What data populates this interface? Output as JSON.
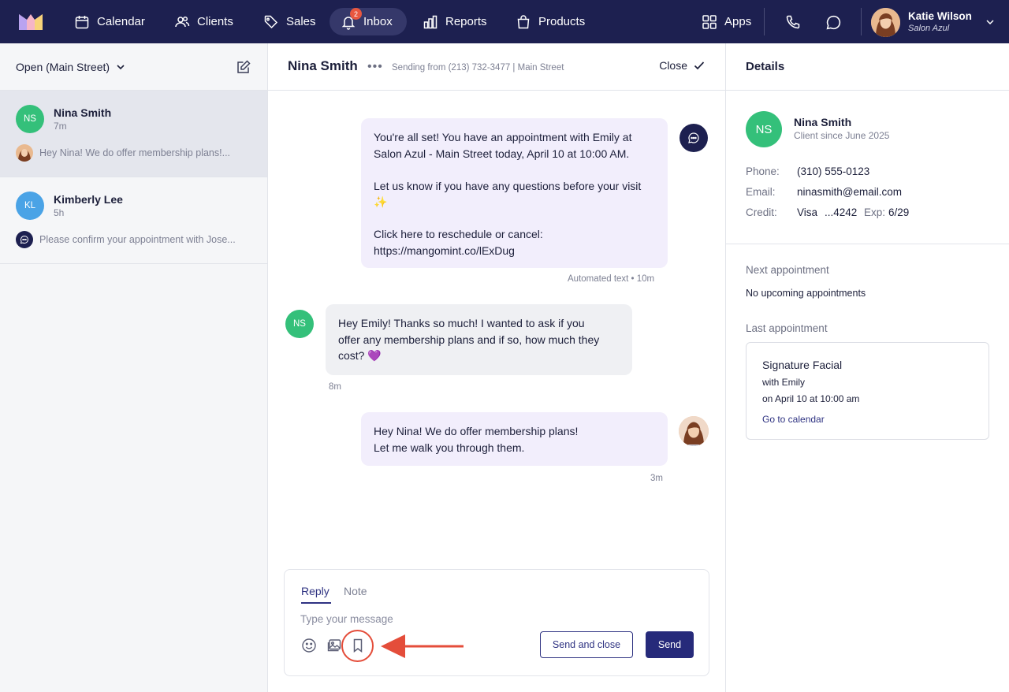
{
  "nav": {
    "items": [
      {
        "label": "Calendar",
        "icon": "calendar-icon"
      },
      {
        "label": "Clients",
        "icon": "clients-icon"
      },
      {
        "label": "Sales",
        "icon": "tag-icon"
      },
      {
        "label": "Inbox",
        "icon": "bell-icon",
        "badge": "2"
      },
      {
        "label": "Reports",
        "icon": "bar-chart-icon"
      },
      {
        "label": "Products",
        "icon": "bag-icon"
      }
    ],
    "apps_label": "Apps",
    "user_name": "Katie Wilson",
    "user_salon": "Salon Azul",
    "accent": "#1d2050",
    "badge_color": "#e8573f"
  },
  "inbox": {
    "filter_label": "Open (Main Street)",
    "conversations": [
      {
        "initials": "NS",
        "name": "Nina Smith",
        "time": "7m",
        "preview": "Hey Nina! We do offer membership plans!...",
        "avatar_color": "#34c07a"
      },
      {
        "initials": "KL",
        "name": "Kimberly Lee",
        "time": "5h",
        "preview": "Please confirm your appointment with Jose...",
        "avatar_color": "#4aa3e6"
      }
    ]
  },
  "chat": {
    "title": "Nina Smith",
    "sending_from": "Sending from (213) 732-3477 | Main Street",
    "close_label": "Close",
    "messages": [
      {
        "direction": "out",
        "lines": [
          "You're all set! You have an appointment with Emily at",
          "Salon Azul - Main Street today, April 10 at 10:00 AM.",
          "",
          "Let us know if you have any questions before your visit",
          "✨",
          "",
          "Click here to reschedule or cancel:",
          "https://mangomint.co/lExDug"
        ],
        "meta": "Automated text • 10m"
      },
      {
        "direction": "in",
        "lines": [
          "Hey Emily! Thanks so much! I wanted to ask if you",
          "offer any membership plans and if so, how much they",
          "cost? 💜"
        ],
        "meta": "8m",
        "initials": "NS"
      },
      {
        "direction": "out",
        "lines": [
          "Hey Nina! We do offer membership plans!",
          "Let me walk you through them."
        ],
        "meta": "3m"
      }
    ],
    "composer": {
      "tab_reply": "Reply",
      "tab_note": "Note",
      "placeholder": "Type your message",
      "send_close_label": "Send and close",
      "send_label": "Send"
    }
  },
  "details": {
    "title": "Details",
    "initials": "NS",
    "client_name": "Nina Smith",
    "client_since": "Client since June 2025",
    "phone_label": "Phone:",
    "phone": "(310) 555-0123",
    "email_label": "Email:",
    "email": "ninasmith@email.com",
    "credit_label": "Credit:",
    "card_brand": "Visa",
    "card_last4": "...4242",
    "exp_label": "Exp:",
    "exp": "6/29",
    "next_label": "Next appointment",
    "next_value": "No upcoming appointments",
    "last_label": "Last appointment",
    "last_appt": {
      "service": "Signature Facial",
      "with": "with Emily",
      "when": "on April 10 at 10:00 am",
      "link": "Go to calendar"
    }
  }
}
